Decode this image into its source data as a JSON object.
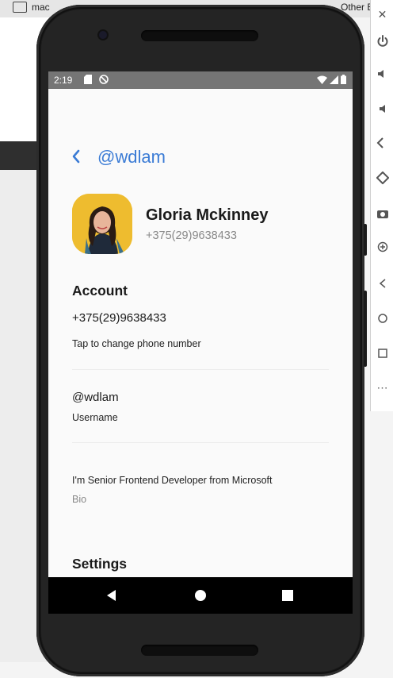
{
  "desktop": {
    "folder_label": "mac",
    "other_label": "Other B"
  },
  "emulator_toolbar": {
    "items": [
      {
        "icon": "close-icon",
        "glyph": "✕"
      },
      {
        "icon": "power-icon",
        "glyph": "⏻"
      },
      {
        "icon": "volume-up-icon",
        "glyph": "🔊"
      },
      {
        "icon": "volume-down-icon",
        "glyph": "🔉"
      },
      {
        "icon": "rotate-left-icon",
        "glyph": "⟲"
      },
      {
        "icon": "rotate-right-icon",
        "glyph": "⟳"
      },
      {
        "icon": "camera-icon",
        "glyph": "◙"
      },
      {
        "icon": "zoom-icon",
        "glyph": "⊕"
      },
      {
        "icon": "back-icon",
        "glyph": "◁"
      },
      {
        "icon": "home-icon",
        "glyph": "○"
      },
      {
        "icon": "overview-icon",
        "glyph": "□"
      },
      {
        "icon": "more-icon",
        "glyph": "⋯"
      }
    ]
  },
  "status_bar": {
    "time": "2:19"
  },
  "header": {
    "title": "@wdlam"
  },
  "profile": {
    "name": "Gloria Mckinney",
    "phone": "+375(29)9638433"
  },
  "account": {
    "section_title": "Account",
    "phone_value": "+375(29)9638433",
    "phone_hint": "Tap to change phone number",
    "username_value": "@wdlam",
    "username_label": "Username",
    "bio_value": "I'm Senior Frontend Developer from Microsoft",
    "bio_label": "Bio"
  },
  "settings": {
    "section_title": "Settings"
  },
  "colors": {
    "accent": "#3a7bd5",
    "status_bar": "#757575",
    "screen_bg": "#fafafa"
  }
}
